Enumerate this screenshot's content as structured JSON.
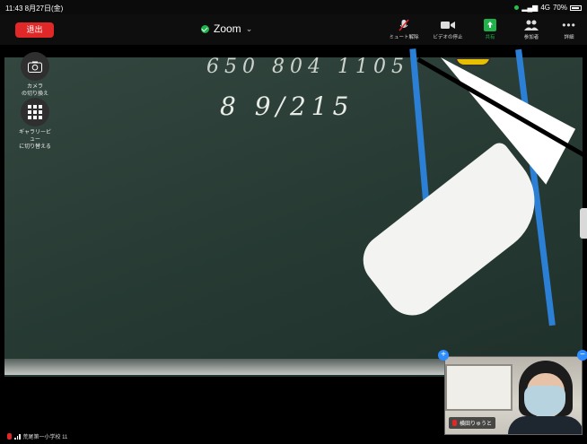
{
  "status_bar": {
    "time": "11:43  8月27日(金)",
    "network": "4G",
    "battery": "70%"
  },
  "toolbar": {
    "leave_label": "退出",
    "title": "Zoom",
    "items": [
      {
        "label": "ミュート解除",
        "icon": "muted-mic-icon"
      },
      {
        "label": "ビデオの停止",
        "icon": "video-camera-icon"
      },
      {
        "label": "共有",
        "icon": "share-screen-icon"
      },
      {
        "label": "参加者",
        "icon": "participants-icon"
      },
      {
        "label": "詳細",
        "icon": "more-icon"
      }
    ],
    "colors": {
      "leave": "#e02828",
      "share": "#1fb24a",
      "shield": "#1fb24a"
    }
  },
  "side_buttons": {
    "camera_switch_label": "カメラ\nの切り換え",
    "gallery_view_label": "ギャラリービュー\nに切り替える"
  },
  "board": {
    "top_text": "650 804 1105",
    "number_text": "8 9/215"
  },
  "self_view": {
    "name": "横田りゅうと"
  },
  "speaker": {
    "name": "荒尾第一小学校 11"
  }
}
